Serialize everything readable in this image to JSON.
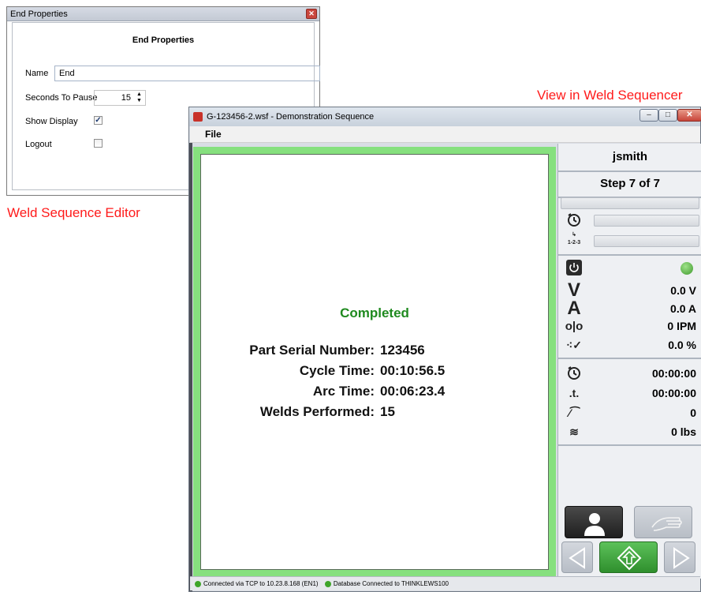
{
  "dialog": {
    "title": "End Properties",
    "heading": "End Properties",
    "name_label": "Name",
    "name_value": "End",
    "seconds_label": "Seconds To Pause",
    "seconds_value": "15",
    "show_display_label": "Show Display",
    "show_display_checked": true,
    "logout_label": "Logout",
    "logout_checked": false
  },
  "annotations": {
    "editor_caption": "Weld Sequence Editor",
    "sequencer_caption": "View in Weld Sequencer"
  },
  "window": {
    "title": "G-123456-2.wsf - Demonstration Sequence",
    "menu": [
      "File"
    ]
  },
  "summary": {
    "status": "Completed",
    "rows": [
      {
        "label": "Part Serial Number:",
        "value": "123456"
      },
      {
        "label": "Cycle Time:",
        "value": "00:10:56.5"
      },
      {
        "label": "Arc Time:",
        "value": "00:06:23.4"
      },
      {
        "label": "Welds Performed:",
        "value": "15"
      }
    ]
  },
  "sidebar": {
    "user": "jsmith",
    "step": "Step 7 of 7",
    "step_icon_label": "1-2-3",
    "power_state": "on",
    "voltage": "0.0 V",
    "current": "0.0 A",
    "wire_speed": "0 IPM",
    "percent": "0.0 %",
    "timer1": "00:00:00",
    "timer2": "00:00:00",
    "count": "0",
    "weight": "0 lbs",
    "icons": {
      "timer": "timer-icon",
      "step": "step-counter-icon",
      "power": "power-icon",
      "voltage": "voltage-icon",
      "amps": "amps-icon",
      "wire": "wire-feed-icon",
      "percent": "weld-percent-icon",
      "arc_timer": "arc-timer-icon",
      "torch_time": "torch-time-icon",
      "weld_count": "weld-count-icon",
      "wire_weight": "wire-weight-icon"
    }
  },
  "status_bar": {
    "tcp": "Connected via TCP to 10.23.8.168 (EN1)",
    "db": "Database Connected to THINKLEWS100"
  },
  "colors": {
    "caption_red": "#ff1a1a",
    "completed_green": "#1f8a1f",
    "content_border_green": "#86e07e",
    "status_led_green": "#3fa52a"
  }
}
